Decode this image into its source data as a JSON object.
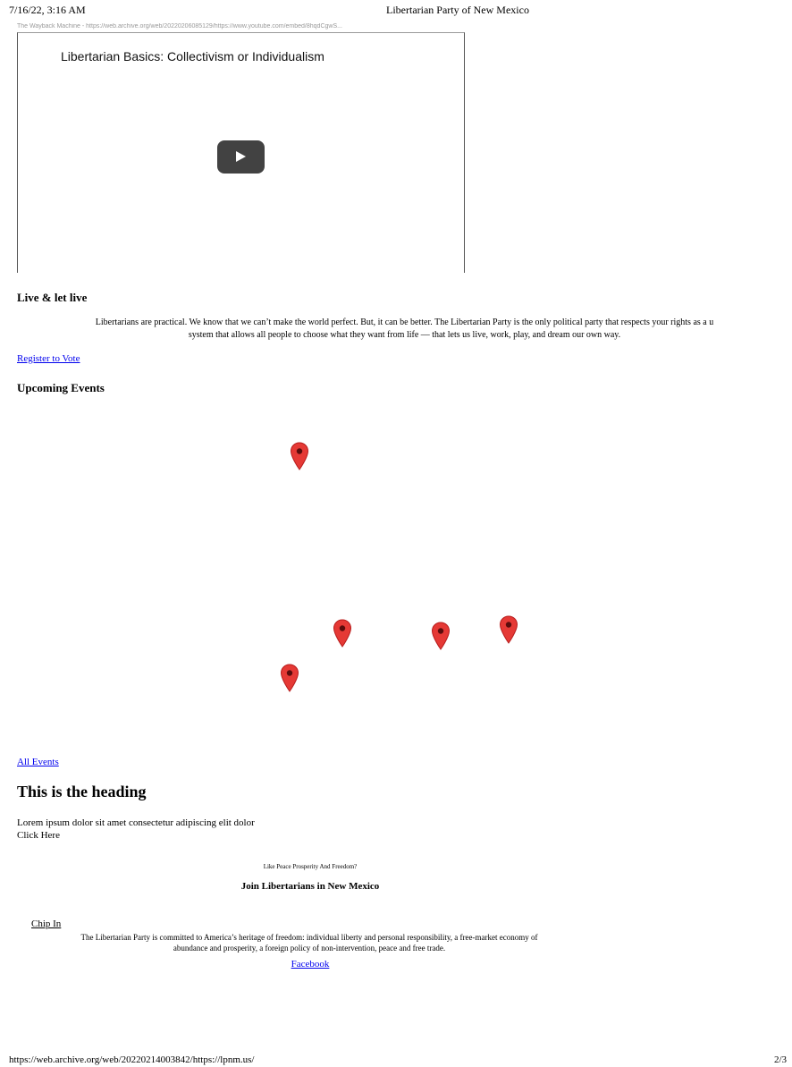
{
  "print_header": {
    "datetime": "7/16/22, 3:16 AM",
    "page_title": "Libertarian Party of New Mexico"
  },
  "wayback_line": "The Wayback Machine - https://web.archive.org/web/20220206085129/https://www.youtube.com/embed/8hqdCgwS...",
  "video": {
    "title": "Libertarian Basics: Collectivism or Individualism",
    "play_icon": "play-icon"
  },
  "live_section": {
    "heading": "Live & let live",
    "lines": [
      "Libertarians are practical. We know that we can’t make the world perfect. But, it can be better. The Libertarian Party is the only political party that respects your rights as a u",
      "system that allows all people to choose what they want from life — that lets us live, work, play, and dream our own way."
    ],
    "register_link": "Register to Vote"
  },
  "events": {
    "heading": "Upcoming Events",
    "pin_icon": "map-pin-icon",
    "pin_color": "#e53935",
    "pin_count": 5,
    "all_events_link": "All Events"
  },
  "promo": {
    "heading": "This is the heading",
    "body": "Lorem ipsum dolor sit amet consectetur adipiscing elit dolor",
    "cta": "Click Here"
  },
  "footer": {
    "tagline": "Like Peace Prosperity And Freedom?",
    "join_heading": "Join Libertarians in New Mexico",
    "chip_in": "Chip In",
    "mission_lines": [
      "The Libertarian Party is committed to America’s heritage of freedom: individual liberty and personal responsibility, a free-market economy of",
      "abundance and prosperity, a foreign policy of non-intervention, peace and free trade."
    ],
    "facebook_link": "Facebook"
  },
  "print_footer": {
    "url": "https://web.archive.org/web/20220214003842/https://lpnm.us/",
    "page": "2/3"
  }
}
